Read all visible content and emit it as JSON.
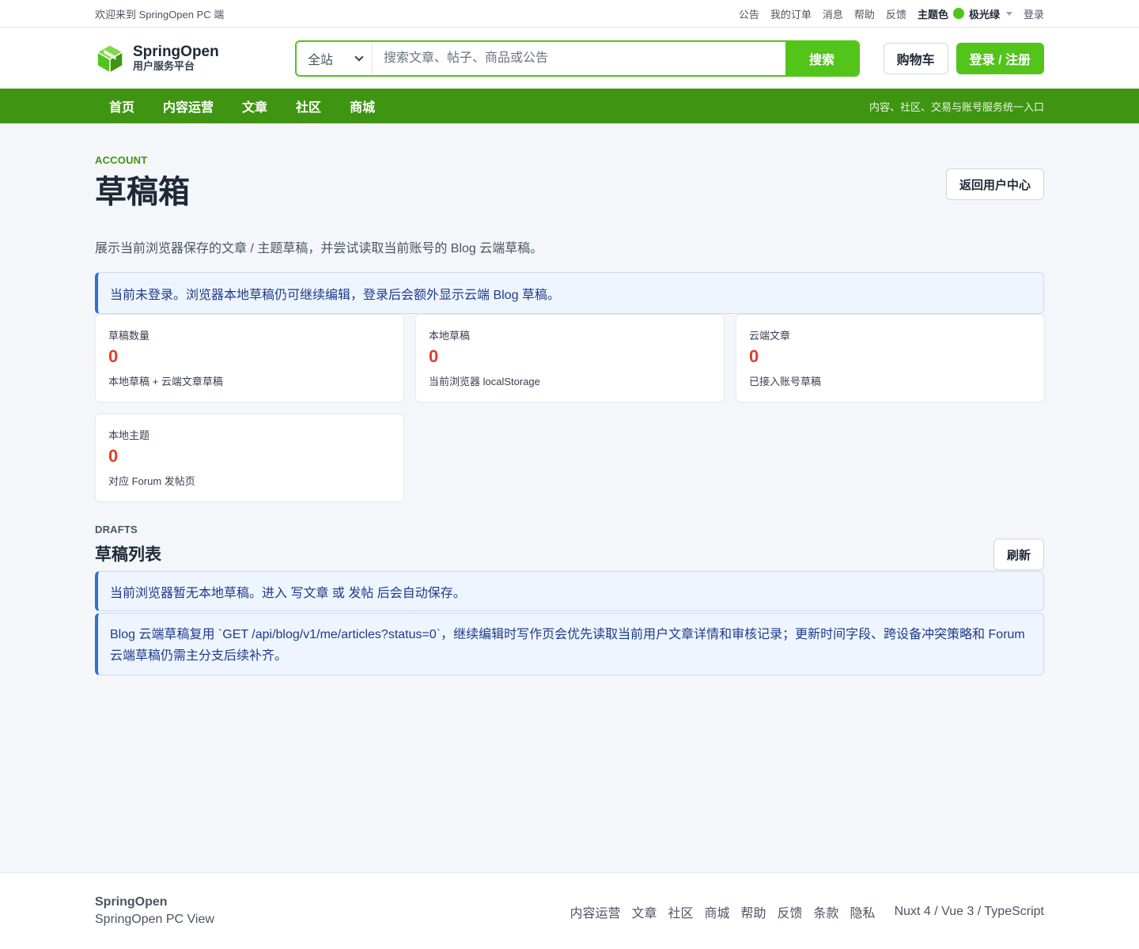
{
  "topbar": {
    "welcome": "欢迎来到 SpringOpen PC 端",
    "links": [
      "公告",
      "我的订单",
      "消息",
      "帮助",
      "反馈"
    ],
    "theme_label": "主题色",
    "theme_name": "极光绿",
    "theme_color": "#52c41a",
    "login": "登录"
  },
  "header": {
    "brand_name": "SpringOpen",
    "brand_sub": "用户服务平台",
    "logo_icon": "cube-logo-icon",
    "search_scope": "全站",
    "search_placeholder": "搜索文章、帖子、商品或公告",
    "search_button": "搜索",
    "cart_button": "购物车",
    "login_button": "登录 / 注册"
  },
  "nav": {
    "items": [
      "首页",
      "内容运营",
      "文章",
      "社区",
      "商城"
    ],
    "tagline": "内容、社区、交易与账号服务统一入口"
  },
  "page": {
    "eyebrow": "ACCOUNT",
    "title": "草稿箱",
    "back_button": "返回用户中心",
    "description": "展示当前浏览器保存的文章 / 主题草稿，并尝试读取当前账号的 Blog 云端草稿。",
    "login_notice": "当前未登录。浏览器本地草稿仍可继续编辑，登录后会额外显示云端 Blog 草稿。"
  },
  "stats": [
    {
      "label": "草稿数量",
      "value": "0",
      "hint": "本地草稿 + 云端文章草稿"
    },
    {
      "label": "本地草稿",
      "value": "0",
      "hint": "当前浏览器 localStorage"
    },
    {
      "label": "云端文章",
      "value": "0",
      "hint": "已接入账号草稿"
    },
    {
      "label": "本地主题",
      "value": "0",
      "hint": "对应 Forum 发帖页"
    }
  ],
  "drafts": {
    "eyebrow": "DRAFTS",
    "title": "草稿列表",
    "refresh_button": "刷新",
    "empty_notice": "当前浏览器暂无本地草稿。进入 写文章 或 发帖 后会自动保存。",
    "cloud_notice": "Blog 云端草稿复用 `GET /api/blog/v1/me/articles?status=0`，继续编辑时写作页会优先读取当前用户文章详情和审核记录；更新时间字段、跨设备冲突策略和 Forum 云端草稿仍需主分支后续补齐。"
  },
  "footer": {
    "name": "SpringOpen",
    "sub": "SpringOpen PC View",
    "links": [
      "内容运营",
      "文章",
      "社区",
      "商城",
      "帮助",
      "反馈",
      "条款",
      "隐私"
    ],
    "stack": "Nuxt 4 / Vue 3 / TypeScript"
  }
}
